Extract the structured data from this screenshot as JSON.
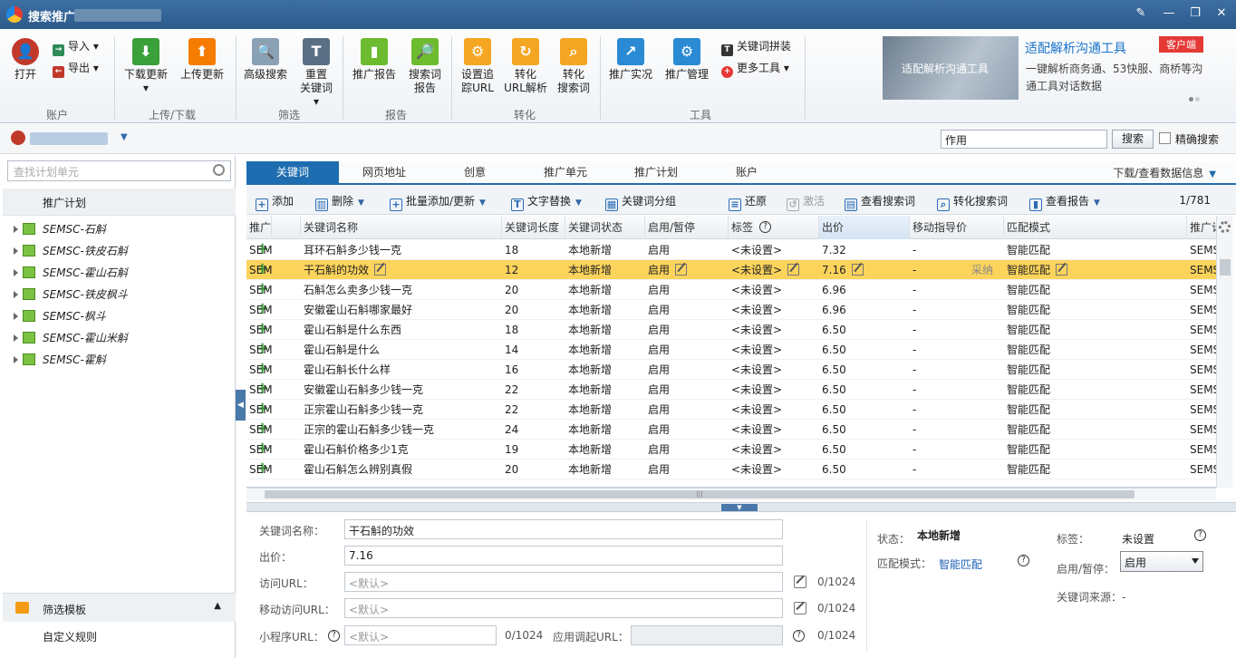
{
  "window": {
    "title": "搜索推广"
  },
  "ribbon": {
    "open": "打开",
    "import": "导入",
    "export": "导出",
    "download_update": "下载更新",
    "upload_update": "上传更新",
    "advanced_search": "高级搜索",
    "reset_keyword_l1": "重置",
    "reset_keyword_l2": "关键词",
    "promo_report": "推广报告",
    "search_term_l1": "搜索词",
    "search_term_l2": "报告",
    "set_track_l1": "设置追",
    "set_track_l2": "踪URL",
    "convert_url_l1": "转化",
    "convert_url_l2": "URL解析",
    "convert_search_l1": "转化",
    "convert_search_l2": "搜索词",
    "promo_live": "推广实况",
    "promo_manage": "推广管理",
    "keyword_combine": "关键词拼装",
    "more_tools": "更多工具",
    "groups": {
      "account": "账户",
      "updown": "上传/下载",
      "filter": "筛选",
      "report": "报告",
      "convert": "转化",
      "tools": "工具"
    }
  },
  "ad": {
    "image_text": "适配解析沟通工具",
    "title": "适配解析沟通工具",
    "badge": "客户端",
    "desc": "一键解析商务通、53快服、商桥等沟通工具对话数据"
  },
  "search": {
    "value": "作用",
    "button": "搜索",
    "exact_label": "精确搜索"
  },
  "left": {
    "search_placeholder": "查找计划单元",
    "header": "推广计划",
    "plans": [
      "SEMSC-石斛",
      "SEMSC-铁皮石斛",
      "SEMSC-霍山石斛",
      "SEMSC-铁皮枫斗",
      "SEMSC-枫斗",
      "SEMSC-霍山米斛",
      "SEMSC-霍斛"
    ],
    "filter_template": "筛选模板",
    "custom_rule": "自定义规则"
  },
  "tabs": [
    "关键词",
    "网页地址",
    "创意",
    "推广单元",
    "推广计划",
    "账户"
  ],
  "tab_right": "下载/查看数据信息",
  "toolbar": {
    "add": "添加",
    "delete": "删除",
    "batch": "批量添加/更新",
    "replace": "文字替换",
    "group": "关键词分组",
    "restore": "还原",
    "activate": "激活",
    "view_search": "查看搜索词",
    "convert_search": "转化搜索词",
    "view_report": "查看报告",
    "pager": "1/781"
  },
  "grid": {
    "columns": [
      "关键词名称",
      "关键词长度",
      "关键词状态",
      "启用/暂停",
      "标签",
      "出价",
      "移动指导价",
      "匹配模式",
      "推广计划名称",
      "推广"
    ],
    "adopt_label": "采纳",
    "rows": [
      [
        "耳环石斛多少钱一克",
        "18",
        "本地新增",
        "启用",
        "<未设置>",
        "7.32",
        "-",
        "智能匹配",
        "SEMSC-石斛",
        "SEM"
      ],
      [
        "干石斛的功效",
        "12",
        "本地新增",
        "启用",
        "<未设置>",
        "7.16",
        "-",
        "智能匹配",
        "SEMSC-石斛",
        "SEM"
      ],
      [
        "石斛怎么卖多少钱一克",
        "20",
        "本地新增",
        "启用",
        "<未设置>",
        "6.96",
        "-",
        "智能匹配",
        "SEMSC-石斛",
        "SEM"
      ],
      [
        "安徽霍山石斛哪家最好",
        "20",
        "本地新增",
        "启用",
        "<未设置>",
        "6.96",
        "-",
        "智能匹配",
        "SEMSC-霍山石...",
        "SEM"
      ],
      [
        "霍山石斛是什么东西",
        "18",
        "本地新增",
        "启用",
        "<未设置>",
        "6.50",
        "-",
        "智能匹配",
        "SEMSC-霍山石...",
        "SEM"
      ],
      [
        "霍山石斛是什么",
        "14",
        "本地新增",
        "启用",
        "<未设置>",
        "6.50",
        "-",
        "智能匹配",
        "SEMSC-霍山石...",
        "SEM"
      ],
      [
        "霍山石斛长什么样",
        "16",
        "本地新增",
        "启用",
        "<未设置>",
        "6.50",
        "-",
        "智能匹配",
        "SEMSC-霍山石...",
        "SEM"
      ],
      [
        "安徽霍山石斛多少钱一克",
        "22",
        "本地新增",
        "启用",
        "<未设置>",
        "6.50",
        "-",
        "智能匹配",
        "SEMSC-霍山石...",
        "SEM"
      ],
      [
        "正宗霍山石斛多少钱一克",
        "22",
        "本地新增",
        "启用",
        "<未设置>",
        "6.50",
        "-",
        "智能匹配",
        "SEMSC-霍山石...",
        "SEM"
      ],
      [
        "正宗的霍山石斛多少钱一克",
        "24",
        "本地新增",
        "启用",
        "<未设置>",
        "6.50",
        "-",
        "智能匹配",
        "SEMSC-霍山石...",
        "SEM"
      ],
      [
        "霍山石斛价格多少1克",
        "19",
        "本地新增",
        "启用",
        "<未设置>",
        "6.50",
        "-",
        "智能匹配",
        "SEMSC-霍山石...",
        "SEM"
      ],
      [
        "霍山石斛怎么辨别真假",
        "20",
        "本地新增",
        "启用",
        "<未设置>",
        "6.50",
        "-",
        "智能匹配",
        "SEMSC-霍山石...",
        "SEM"
      ]
    ]
  },
  "detail": {
    "kw_label": "关键词名称：",
    "kw_value": "干石斛的功效",
    "bid_label": "出价：",
    "bid_value": "7.16",
    "url_label": "访问URL：",
    "url_placeholder": "<默认>",
    "url_count": "0/1024",
    "murl_label": "移动访问URL：",
    "murl_placeholder": "<默认>",
    "murl_count": "0/1024",
    "mini_label": "小程序URL：",
    "mini_placeholder": "<默认>",
    "mini_count": "0/1024",
    "app_label": "应用调起URL：",
    "app_count": "0/1024",
    "status_label": "状态：",
    "status_value": "本地新增",
    "match_label": "匹配模式：",
    "match_value": "智能匹配",
    "tag_label": "标签：",
    "tag_value": "未设置",
    "enable_label": "启用/暂停：",
    "enable_value": "启用",
    "source_label": "关键词来源：-"
  },
  "colors": {
    "titlebar": "#2c5a8c",
    "accent": "#1e6db0",
    "selected_row": "#fcd45c",
    "plan_icon": "#7cc242"
  }
}
